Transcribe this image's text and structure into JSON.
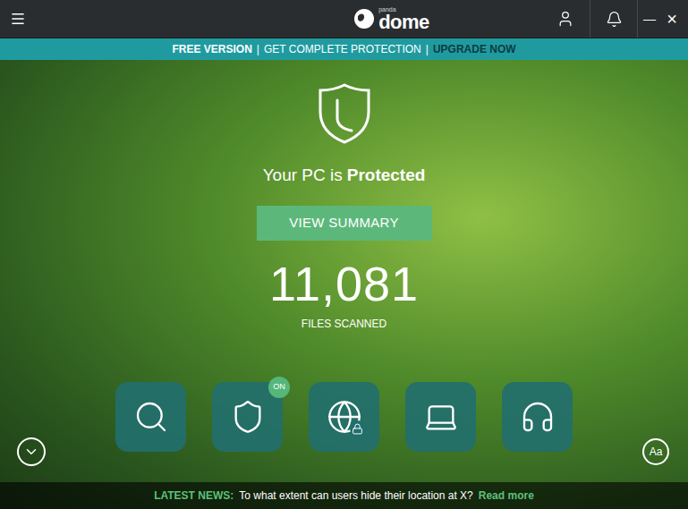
{
  "window": {
    "logo_brand": "panda",
    "logo": "dome",
    "controls": [
      "—",
      "×"
    ]
  },
  "banner": {
    "free": "FREE VERSION",
    "separator": "|",
    "offer": "GET COMPLETE PROTECTION",
    "upgrade": "UPGRADE NOW"
  },
  "status": {
    "prefix": "Your PC is",
    "state": "Protected"
  },
  "summary_button": "VIEW SUMMARY",
  "scan": {
    "count": "11,081",
    "label": "FILES SCANNED"
  },
  "features": [
    {
      "on": false,
      "badge": ""
    },
    {
      "on": true,
      "badge": "ON"
    },
    {
      "on": false,
      "badge": ""
    },
    {
      "on": false,
      "badge": ""
    },
    {
      "on": false,
      "badge": ""
    }
  ],
  "font_button": "Aa",
  "news": {
    "label": "LATEST NEWS:",
    "headline": "To what extent can users hide their location at X?",
    "link": "Read more"
  }
}
